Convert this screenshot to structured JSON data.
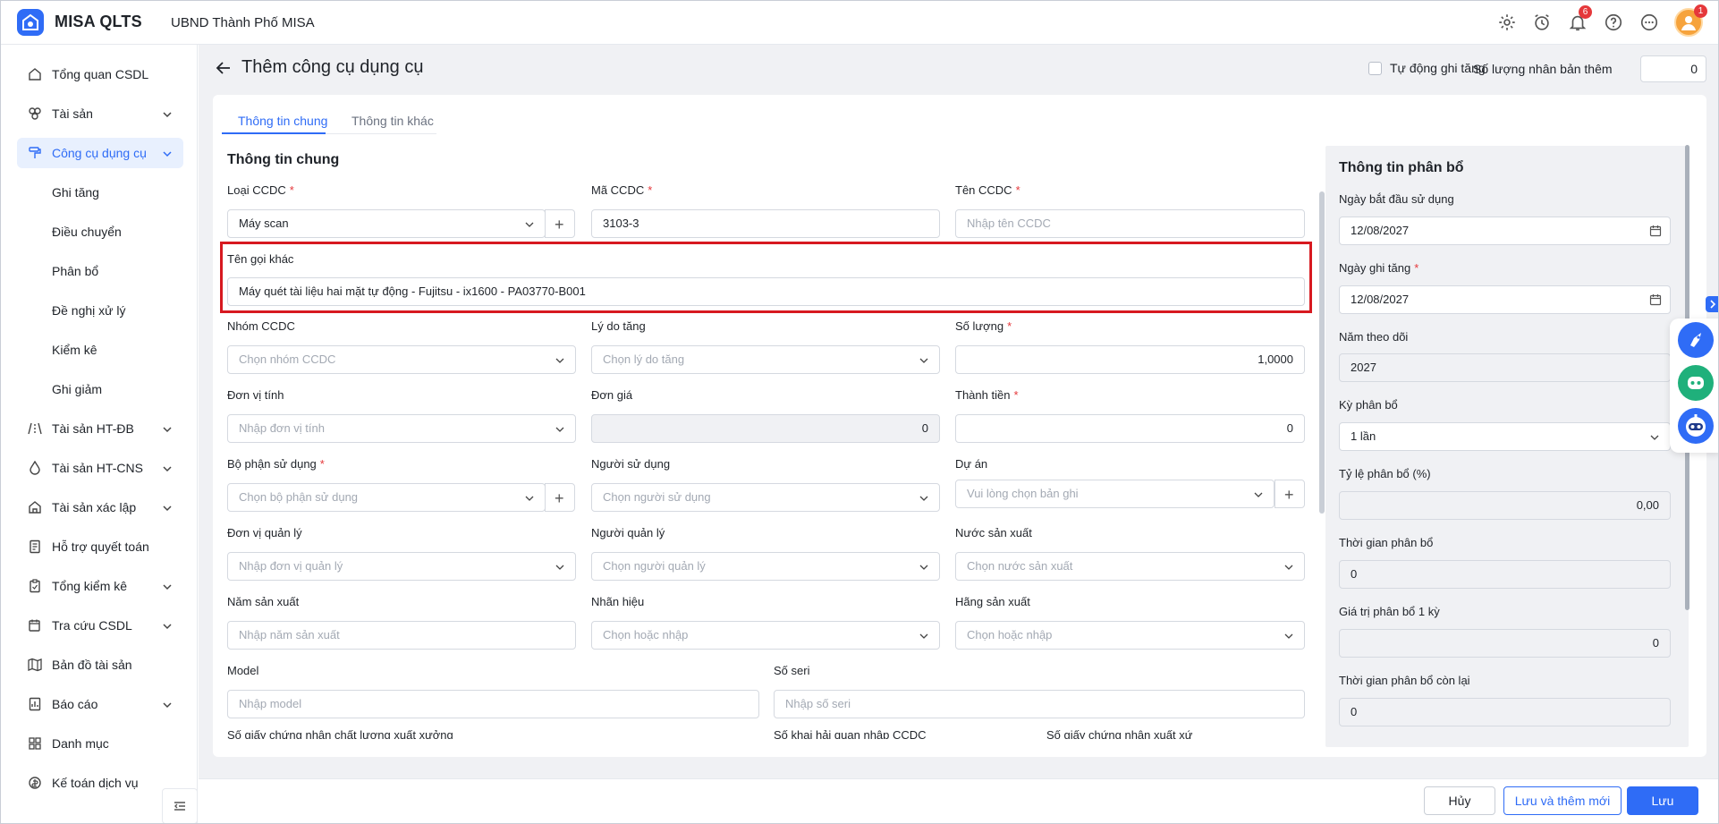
{
  "header": {
    "brand": "MISA QLTS",
    "org": "UBND Thành Phố MISA",
    "notification_count": "6",
    "avatar_badge": "1"
  },
  "sidebar": {
    "items": [
      {
        "label": "Tổng quan CSDL",
        "icon": "home-icon"
      },
      {
        "label": "Tài sản",
        "icon": "assets-icon"
      },
      {
        "label": "Công cụ dụng cụ",
        "icon": "paint-roller-icon"
      },
      {
        "label": "Tài sản HT-ĐB",
        "icon": "road-icon"
      },
      {
        "label": "Tài sản HT-CNS",
        "icon": "water-drop-icon"
      },
      {
        "label": "Tài sản xác lập",
        "icon": "home-outline-icon"
      },
      {
        "label": "Hỗ trợ quyết toán",
        "icon": "document-icon"
      },
      {
        "label": "Tổng kiểm kê",
        "icon": "clipboard-icon"
      },
      {
        "label": "Tra cứu CSDL",
        "icon": "calendar-search-icon"
      },
      {
        "label": "Bản đồ tài sản",
        "icon": "map-icon"
      },
      {
        "label": "Báo cáo",
        "icon": "report-icon"
      },
      {
        "label": "Danh mục",
        "icon": "grid-icon"
      },
      {
        "label": "Kế toán dịch vụ",
        "icon": "accounting-icon"
      }
    ],
    "subitems": [
      "Ghi tăng",
      "Điều chuyển",
      "Phân bổ",
      "Đề nghị xử lý",
      "Kiểm kê",
      "Ghi giảm"
    ]
  },
  "page": {
    "title": "Thêm công cụ dụng cụ",
    "auto_label": "Tự động ghi tăng",
    "copies_label": "Số lượng nhân bản thêm",
    "copies_value": "0",
    "tabs": [
      "Thông tin chung",
      "Thông tin khác"
    ]
  },
  "form": {
    "section_title": "Thông tin chung",
    "loai_label": "Loại CCDC",
    "loai_value": "Máy scan",
    "ma_label": "Mã CCDC",
    "ma_value": "3103-3",
    "ten_label": "Tên CCDC",
    "ten_placeholder": "Nhập tên CCDC",
    "ten_goi_khac_label": "Tên gọi khác",
    "ten_goi_khac_value": "Máy quét tài liệu hai mặt tự động - Fujitsu - ix1600 - PA03770-B001",
    "nhom_label": "Nhóm CCDC",
    "nhom_placeholder": "Chọn nhóm CCDC",
    "lydo_label": "Lý do tăng",
    "lydo_placeholder": "Chọn lý do tăng",
    "soluong_label": "Số lượng",
    "soluong_value": "1,0000",
    "dvt_label": "Đơn vị tính",
    "dvt_placeholder": "Nhập đơn vị tính",
    "dongia_label": "Đơn giá",
    "dongia_value": "0",
    "thanhtien_label": "Thành tiền",
    "thanhtien_value": "0",
    "bophan_label": "Bộ phận sử dụng",
    "bophan_placeholder": "Chọn bộ phận sử dụng",
    "nguoisd_label": "Người sử dụng",
    "nguoisd_placeholder": "Chọn người sử dụng",
    "duan_label": "Dự án",
    "duan_placeholder": "Vui lòng chọn bản ghi",
    "dvql_label": "Đơn vị quản lý",
    "dvql_placeholder": "Nhập đơn vị quản lý",
    "nguoiql_label": "Người quản lý",
    "nguoiql_placeholder": "Chọn người quản lý",
    "nuocsx_label": "Nước sản xuất",
    "nuocsx_placeholder": "Chọn nước sản xuất",
    "namsx_label": "Năm sản xuất",
    "namsx_placeholder": "Nhập năm sản xuất",
    "nhanhieu_label": "Nhãn hiệu",
    "nhanhieu_placeholder": "Chọn hoặc nhập",
    "hangsx_label": "Hãng sản xuất",
    "hangsx_placeholder": "Chọn hoặc nhập",
    "model_label": "Model",
    "model_placeholder": "Nhập model",
    "seri_label": "Số seri",
    "seri_placeholder": "Nhập số seri",
    "cert1_label": "Số giấy chứng nhận chất lượng xuất xưởng",
    "cert2_label": "Số khai hải quan nhập CCDC",
    "cert3_label": "Số giấy chứng nhận xuất xứ"
  },
  "allocation": {
    "title": "Thông tin phân bổ",
    "start_label": "Ngày bắt đầu sử dụng",
    "start_value": "12/08/2027",
    "record_label": "Ngày ghi tăng",
    "record_value": "12/08/2027",
    "year_label": "Năm theo dõi",
    "year_value": "2027",
    "period_label": "Kỳ phân bổ",
    "period_value": "1 lần",
    "rate_label": "Tỷ lệ phân bổ (%)",
    "rate_value": "0,00",
    "duration_label": "Thời gian phân bổ",
    "duration_value": "0",
    "value_label": "Giá trị phân bổ 1 kỳ",
    "value_value": "0",
    "remaining_label": "Thời gian phân bổ còn lại",
    "remaining_value": "0"
  },
  "footer": {
    "cancel": "Hủy",
    "save_new": "Lưu và thêm mới",
    "save": "Lưu"
  },
  "colors": {
    "primary": "#2f6cf6",
    "required": "#e5383b",
    "highlight": "#d71920"
  }
}
